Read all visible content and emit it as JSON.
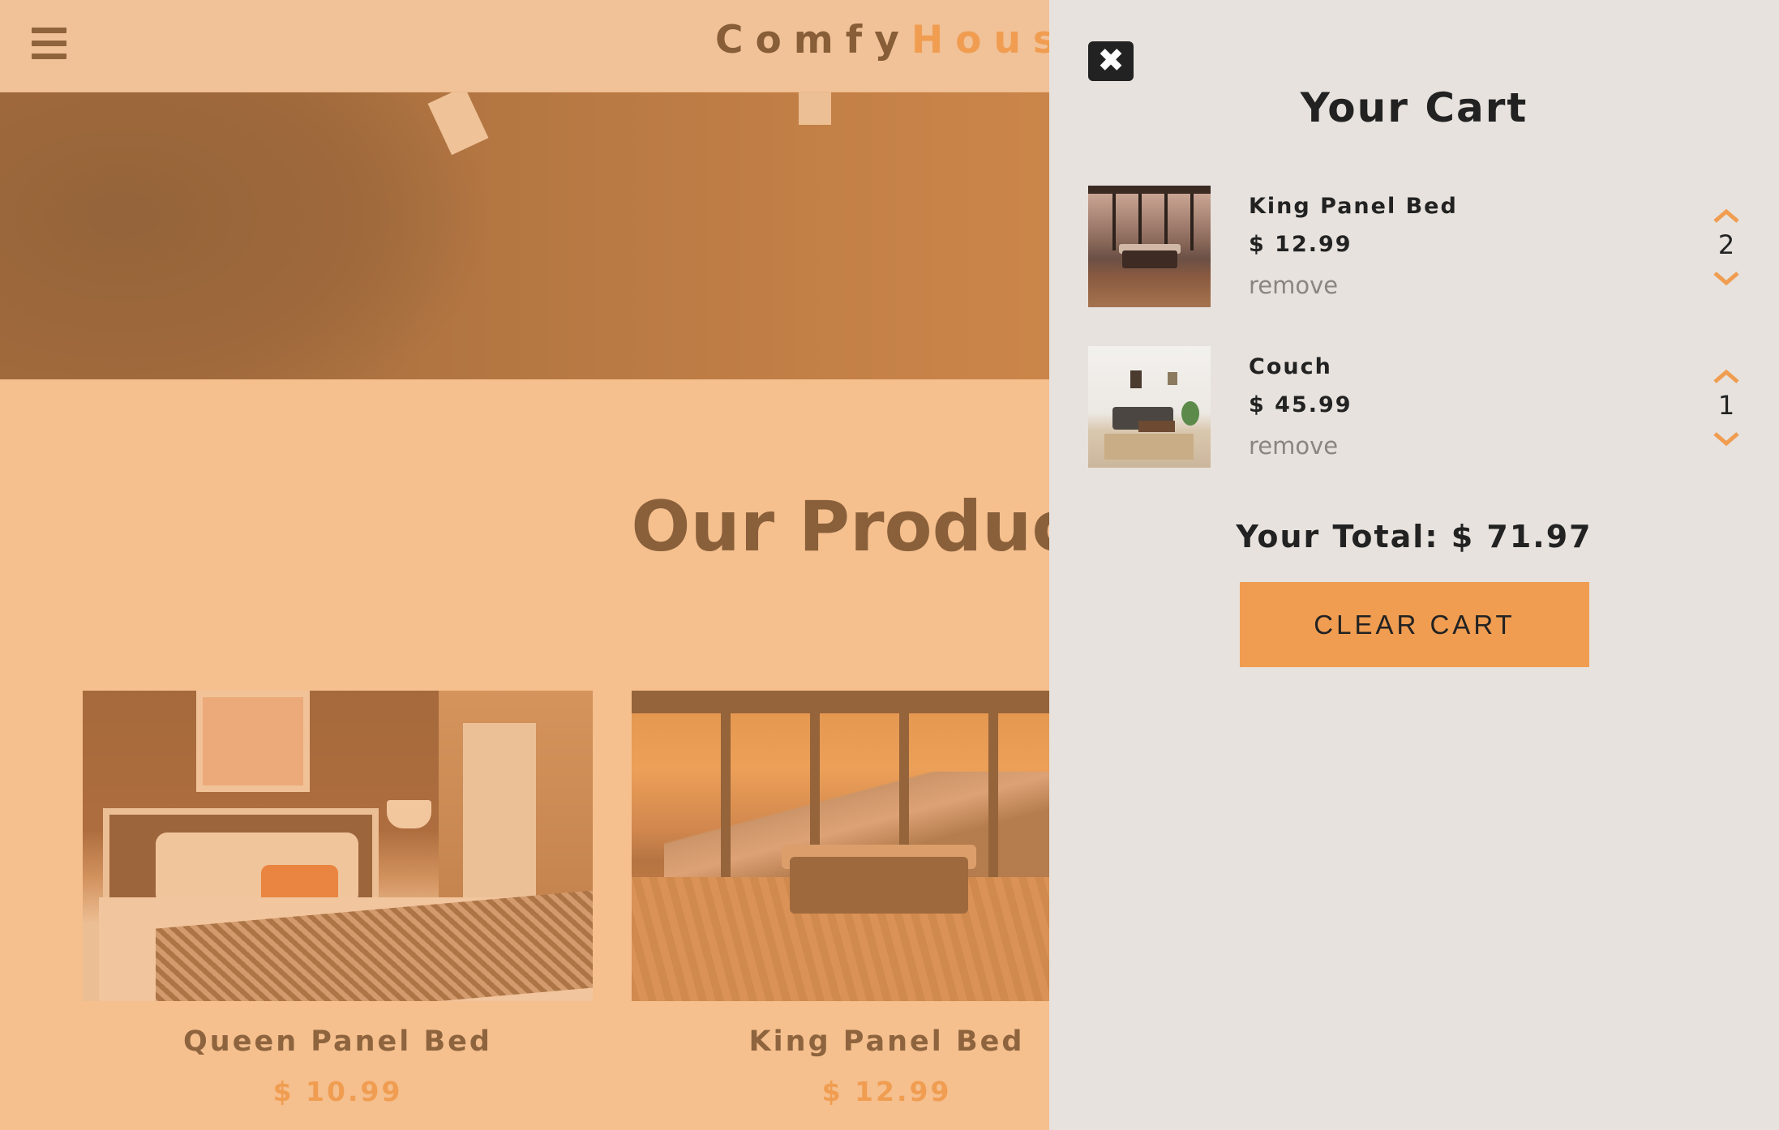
{
  "navbar": {
    "logo_part1": "Comfy",
    "logo_part2": "House",
    "menu_icon": "hamburger-menu-icon"
  },
  "main": {
    "section_title": "Our Products",
    "products": [
      {
        "name": "Queen Panel Bed",
        "price": "$ 10.99"
      },
      {
        "name": "King Panel Bed",
        "price": "$ 12.99"
      }
    ]
  },
  "cart": {
    "close_icon": "close-x-icon",
    "title": "Your Cart",
    "items": [
      {
        "name": "King Panel Bed",
        "price": "$ 12.99",
        "remove_label": "remove",
        "quantity": "2"
      },
      {
        "name": "Couch",
        "price": "$ 45.99",
        "remove_label": "remove",
        "quantity": "1"
      }
    ],
    "total_label": "Your Total: $ 71.97",
    "clear_label": "CLEAR CART"
  },
  "colors": {
    "accent": "#f09d51",
    "cart_bg": "#e7e2dd",
    "overlay": "rgba(240,157,81,0.5)"
  }
}
